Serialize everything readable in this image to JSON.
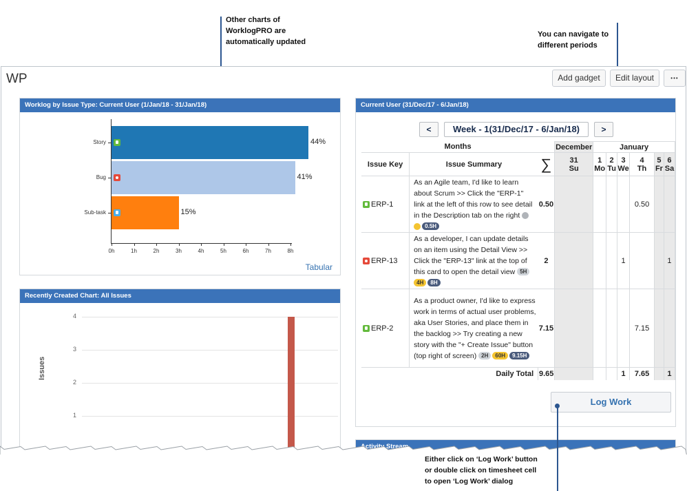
{
  "callouts": {
    "charts_updated": "Other charts of\nWorklogPRO are\nautomatically updated",
    "navigate": "You can navigate to\ndifferent periods",
    "log_work_hint": "Either click on ‘Log Work’ button\nor double click on timesheet cell\nto open ‘Log Work’ dialog"
  },
  "dashboard": {
    "title": "WP",
    "add_gadget": "Add gadget",
    "edit_layout": "Edit layout",
    "more": "•••"
  },
  "worklog_gadget": {
    "title": "Worklog by Issue Type: Current User (1/Jan/18 - 31/Jan/18)",
    "tabular_link": "Tabular",
    "chart_data": {
      "type": "bar",
      "orientation": "horizontal",
      "categories": [
        "Story",
        "Bug",
        "Sub-task"
      ],
      "values": [
        8.8,
        8.2,
        3.0
      ],
      "value_labels": [
        "44%",
        "41%",
        "15%"
      ],
      "colors": [
        "#1f77b4",
        "#aec7e8",
        "#ff7f0e"
      ],
      "x_ticks": [
        "0h",
        "1h",
        "2h",
        "3h",
        "4h",
        "5h",
        "6h",
        "7h",
        "8h"
      ],
      "xlim": [
        0,
        8.8
      ]
    }
  },
  "recent_gadget": {
    "title": "Recently Created Chart: All Issues",
    "chart_data": {
      "type": "bar",
      "ylabel": "Issues",
      "y_ticks": [
        "1",
        "2",
        "3",
        "4"
      ],
      "ylim": [
        0,
        4
      ],
      "values": [
        4
      ],
      "colors": [
        "#c4584a"
      ]
    }
  },
  "timesheet": {
    "title": "Current User (31/Dec/17 - 6/Jan/18)",
    "prev": "<",
    "next": ">",
    "period": "Week - 1(31/Dec/17 - 6/Jan/18)",
    "months_label": "Months",
    "december": "December",
    "january": "January",
    "issue_key_header": "Issue Key",
    "issue_summary_header": "Issue Summary",
    "sigma": "∑",
    "days": [
      {
        "num": "31",
        "dow": "Su"
      },
      {
        "num": "1",
        "dow": "Mo"
      },
      {
        "num": "2",
        "dow": "Tu"
      },
      {
        "num": "3",
        "dow": "We"
      },
      {
        "num": "4",
        "dow": "Th"
      },
      {
        "num": "5",
        "dow": "Fr"
      },
      {
        "num": "6",
        "dow": "Sa"
      }
    ],
    "rows": [
      {
        "key": "ERP-1",
        "type": "story",
        "summary": "As an Agile team, I'd like to learn about Scrum >> Click the \"ERP-1\" link at the left of this row to see detail in the Description tab on the right",
        "badges": [
          {
            "kind": "dot-gray",
            "text": ""
          },
          {
            "kind": "dot-yellow",
            "text": ""
          },
          {
            "kind": "navy",
            "text": "0.5H"
          }
        ],
        "total": "0.50",
        "cells": [
          "",
          "",
          "",
          "",
          "0.50",
          "",
          ""
        ]
      },
      {
        "key": "ERP-13",
        "type": "bug",
        "summary": "As a developer, I can update details on an item using the Detail View >> Click the \"ERP-13\" link at the top of this card to open the detail view",
        "badges": [
          {
            "kind": "gray",
            "text": "5H"
          },
          {
            "kind": "yellow",
            "text": "4H"
          },
          {
            "kind": "navy",
            "text": "8H"
          }
        ],
        "total": "2",
        "cells": [
          "",
          "",
          "",
          "1",
          "",
          "",
          "1"
        ]
      },
      {
        "key": "ERP-2",
        "type": "story",
        "summary": "As a product owner, I'd like to express work in terms of actual user problems, aka User Stories, and place them in the backlog >> Try creating a new story with the \"+ Create Issue\" button (top right of screen)",
        "badges": [
          {
            "kind": "gray",
            "text": "2H"
          },
          {
            "kind": "yellow",
            "text": "60H"
          },
          {
            "kind": "navy",
            "text": "9.15H"
          }
        ],
        "total": "7.15",
        "cells": [
          "",
          "",
          "",
          "",
          "7.15",
          "",
          ""
        ]
      }
    ],
    "daily_total_label": "Daily Total",
    "daily_total_sum": "9.65",
    "daily_totals": [
      "",
      "",
      "",
      "1",
      "7.65",
      "",
      "1"
    ],
    "log_work_button": "Log Work"
  },
  "activity_gadget": {
    "title": "Activity Stream"
  }
}
